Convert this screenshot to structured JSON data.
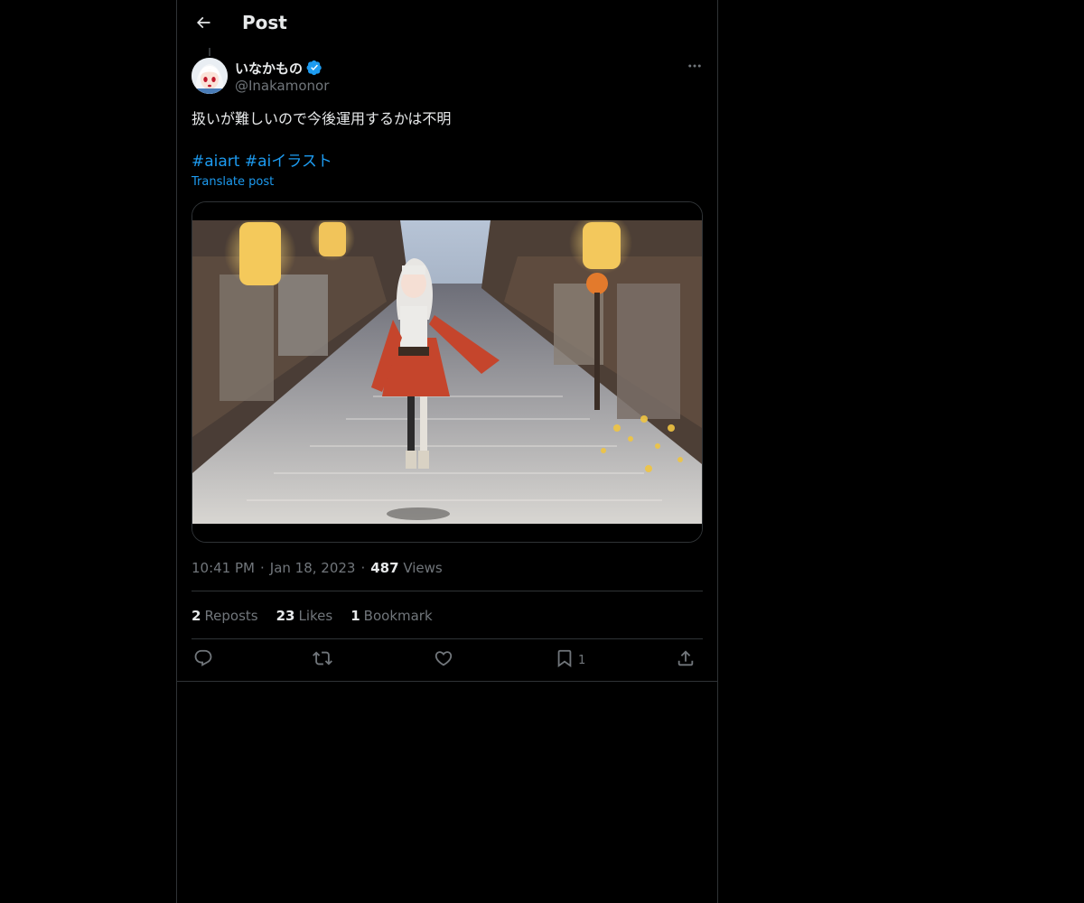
{
  "header": {
    "title": "Post"
  },
  "author": {
    "display_name": "いなかもの",
    "handle": "@Inakamonor",
    "verified": true
  },
  "post": {
    "text": "扱いが難しいので今後運用するかは不明",
    "hashtags": [
      "#aiart",
      "#aiイラスト"
    ],
    "translate_label": "Translate post",
    "media_icon": "anime-illustration-image"
  },
  "meta": {
    "time": "10:41 PM",
    "date": "Jan 18, 2023",
    "views_count": "487",
    "views_label": "Views"
  },
  "stats": {
    "reposts_count": "2",
    "reposts_label": "Reposts",
    "likes_count": "23",
    "likes_label": "Likes",
    "bookmarks_count": "1",
    "bookmarks_label": "Bookmark"
  },
  "actions": {
    "bookmark_count": "1",
    "icons": [
      "reply-icon",
      "repost-icon",
      "like-icon",
      "bookmark-icon",
      "share-icon"
    ]
  },
  "colors": {
    "background": "#000000",
    "text_primary": "#e7e9ea",
    "text_secondary": "#71767b",
    "accent": "#1d9bf0",
    "border": "#2f3336"
  }
}
